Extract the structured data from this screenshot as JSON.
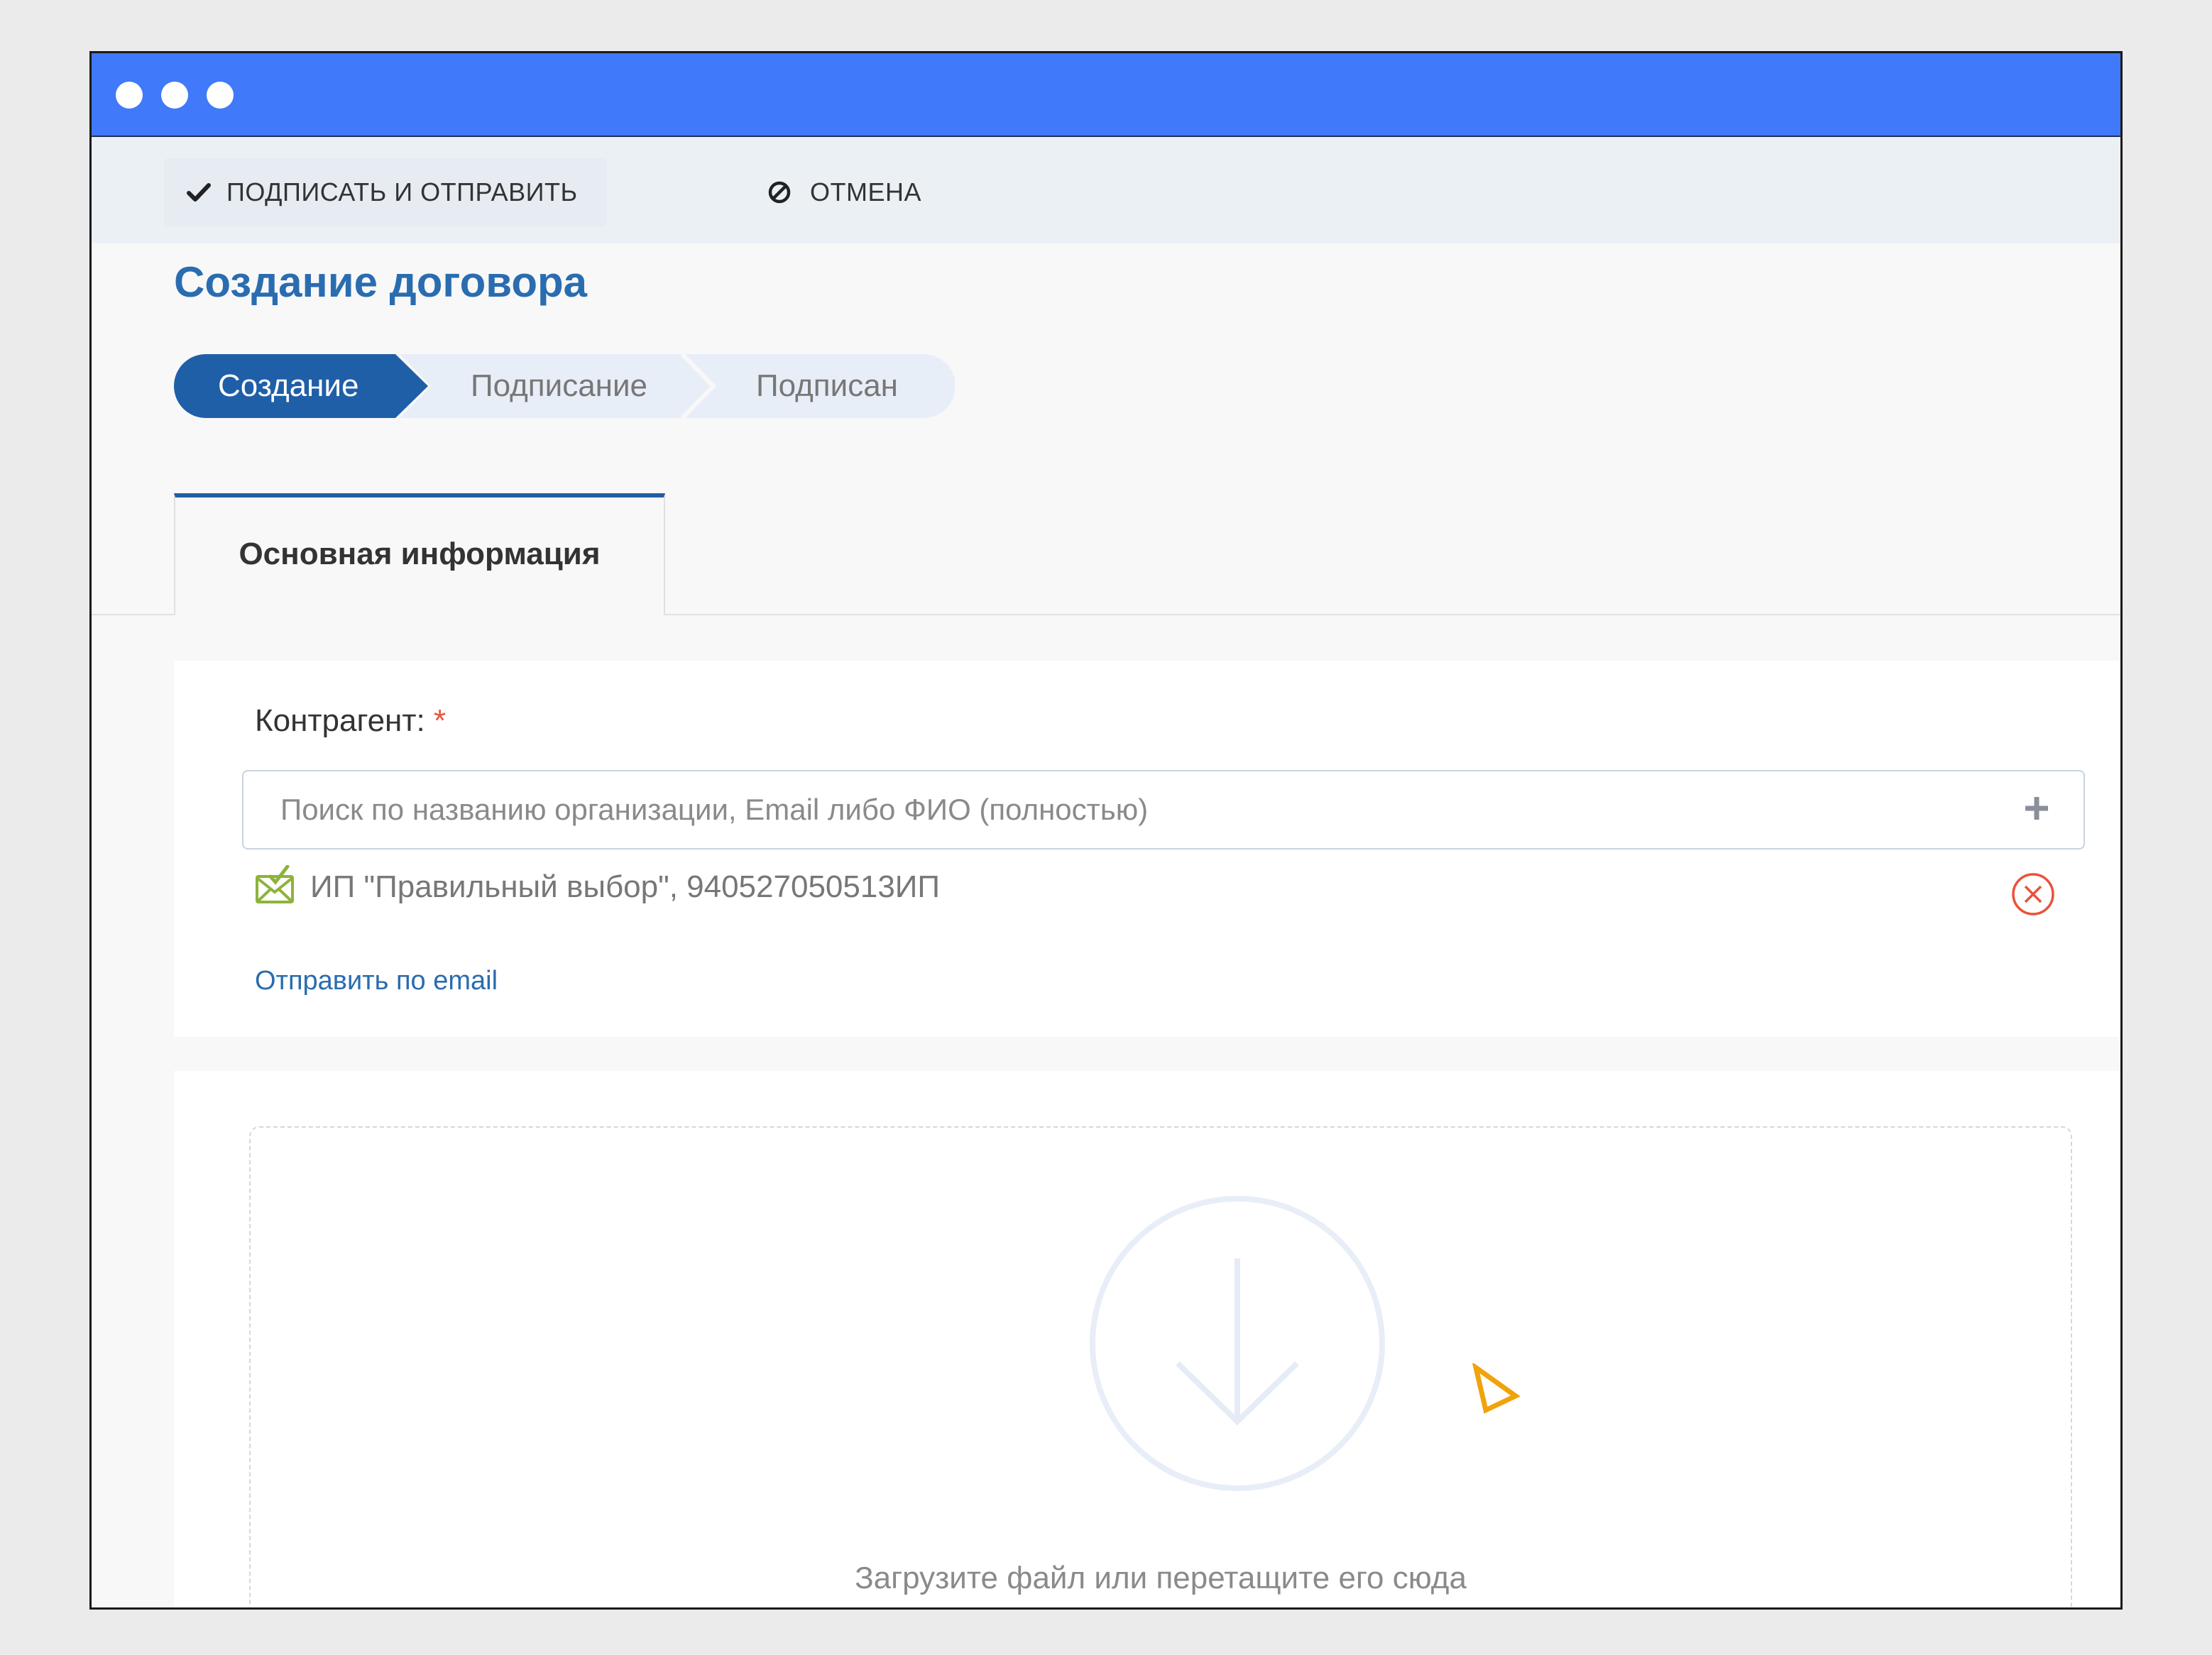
{
  "toolbar": {
    "sign_label": "ПОДПИСАТЬ И ОТПРАВИТЬ",
    "cancel_label": "ОТМЕНА"
  },
  "page": {
    "title": "Создание договора"
  },
  "stepper": {
    "steps": [
      {
        "label": "Создание",
        "state": "active"
      },
      {
        "label": "Подписание",
        "state": "pending"
      },
      {
        "label": "Подписан",
        "state": "pending"
      }
    ]
  },
  "tabs": [
    {
      "label": "Основная информация",
      "active": true
    }
  ],
  "counterparty": {
    "label": "Контрагент:",
    "required_mark": "*",
    "search_placeholder": "Поиск по названию организации, Email либо ФИО (полностью)",
    "search_value": "",
    "selected": "ИП \"Правильный выбор\", 940527050513ИП",
    "send_email_link": "Отправить по email"
  },
  "upload": {
    "hint": "Загрузите файл или перетащите его сюда"
  },
  "colors": {
    "titlebar": "#4079fa",
    "primary": "#1f5fa8",
    "link": "#2a6cb0",
    "danger": "#e8533a",
    "success": "#8db33a",
    "cursor": "#f0a30a"
  }
}
